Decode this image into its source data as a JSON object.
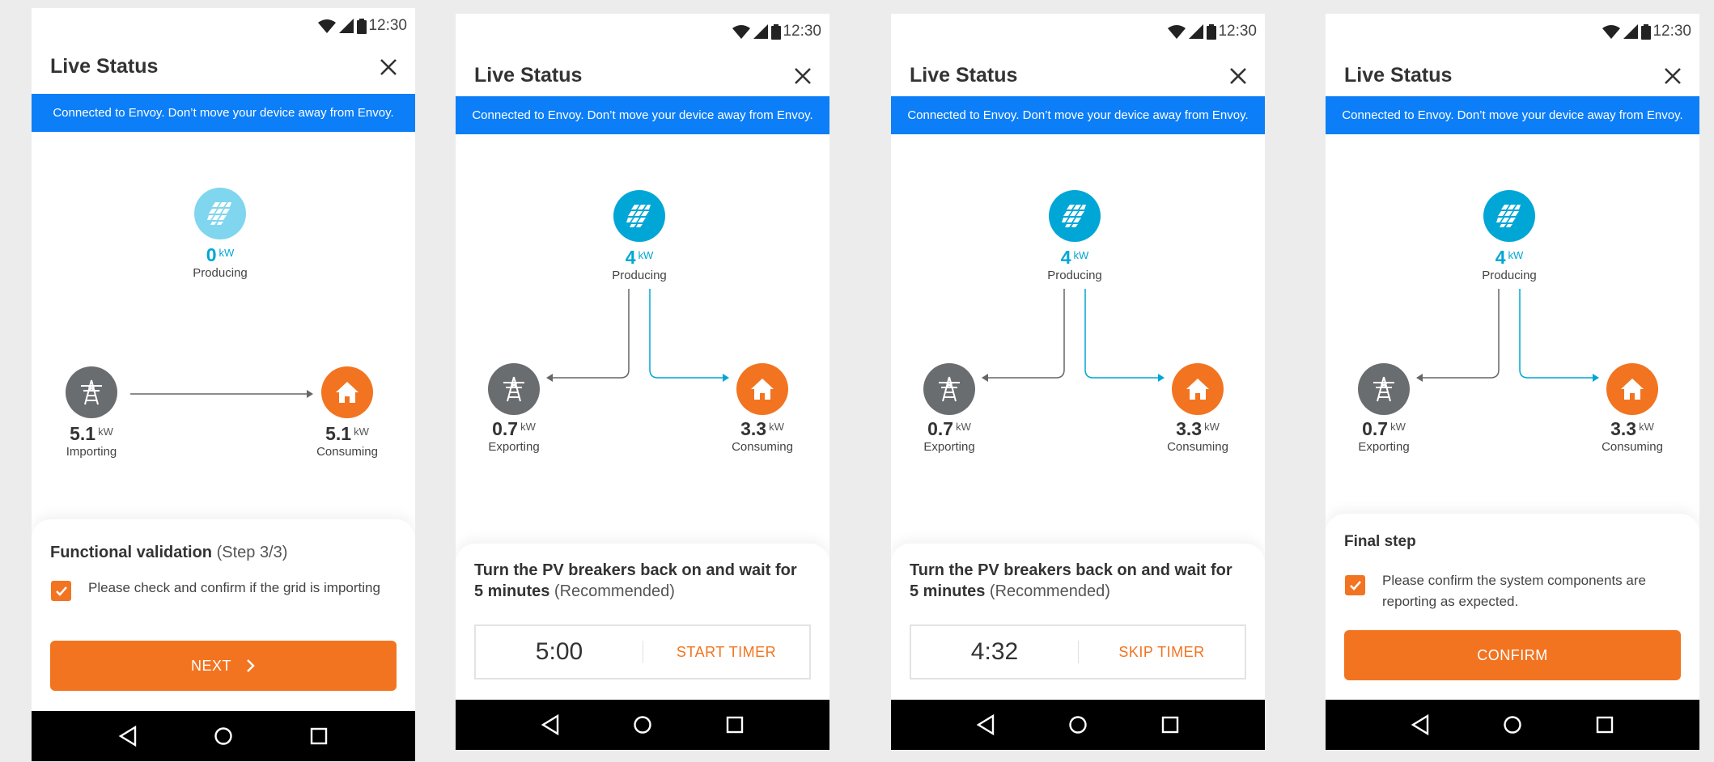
{
  "status_time": "12:30",
  "app_title": "Live Status",
  "banner_text": "Connected to Envoy. Don’t move your device away from Envoy.",
  "unit": "kW",
  "colors": {
    "accent": "#f27420",
    "banner": "#0c7ef7",
    "solar": "#00a6d6",
    "grid": "#6a6d70"
  },
  "icons": [
    "wifi-icon",
    "signal-icon",
    "battery-icon",
    "close-icon",
    "solar-panel-icon",
    "power-tower-icon",
    "home-icon",
    "checkbox-checked-icon",
    "chevron-right-icon",
    "back-icon",
    "home-circle-icon",
    "recents-icon"
  ],
  "screens": [
    {
      "producing": {
        "value": "0",
        "label": "Producing"
      },
      "grid": {
        "value": "5.1",
        "label": "Importing"
      },
      "consuming": {
        "value": "5.1",
        "label": "Consuming"
      },
      "sheet": {
        "title_bold": "Functional validation",
        "title_light": "(Step 3/3)",
        "checkbox_text": "Please check and confirm if the grid is importing",
        "button_label": "NEXT"
      }
    },
    {
      "producing": {
        "value": "4",
        "label": "Producing"
      },
      "grid": {
        "value": "0.7",
        "label": "Exporting"
      },
      "consuming": {
        "value": "3.3",
        "label": "Consuming"
      },
      "sheet": {
        "instruction_bold_1": "Turn the PV breakers back on and wait for",
        "instruction_bold_2": "5 minutes",
        "instruction_light": "(Recommended)",
        "timer_value": "5:00",
        "timer_action": "START TIMER"
      }
    },
    {
      "producing": {
        "value": "4",
        "label": "Producing"
      },
      "grid": {
        "value": "0.7",
        "label": "Exporting"
      },
      "consuming": {
        "value": "3.3",
        "label": "Consuming"
      },
      "sheet": {
        "instruction_bold_1": "Turn the PV breakers back on and wait for",
        "instruction_bold_2": "5 minutes",
        "instruction_light": "(Recommended)",
        "timer_value": "4:32",
        "timer_action": "SKIP TIMER"
      }
    },
    {
      "producing": {
        "value": "4",
        "label": "Producing"
      },
      "grid": {
        "value": "0.7",
        "label": "Exporting"
      },
      "consuming": {
        "value": "3.3",
        "label": "Consuming"
      },
      "sheet": {
        "title_bold": "Final step",
        "checkbox_text": "Please confirm the system components are reporting as expected.",
        "button_label": "CONFIRM"
      }
    }
  ]
}
